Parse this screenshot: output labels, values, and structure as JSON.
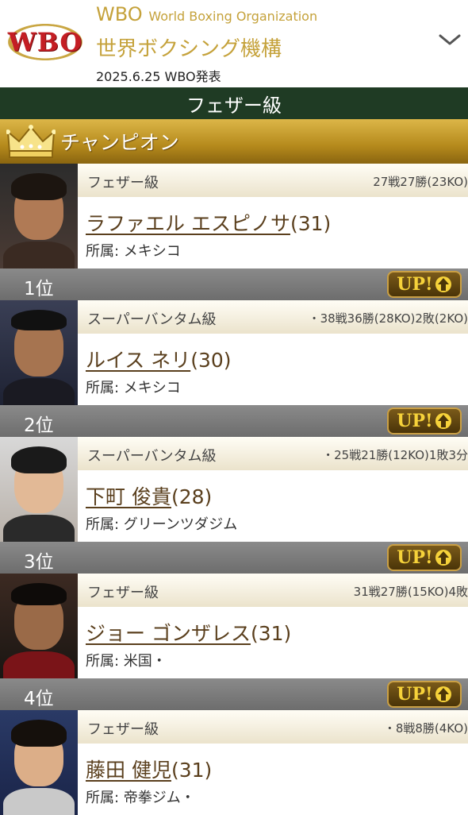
{
  "header": {
    "logo_text": "WBO",
    "org_abbr": "WBO",
    "org_full_en": "World Boxing Organization",
    "org_jp": "世界ボクシング機構",
    "announce": "2025.6.25 WBO発表"
  },
  "weight_class": "フェザー級",
  "champion_label": "チャンピオン",
  "champion": {
    "weight": "フェザー級",
    "record": "27戦27勝(23KO)",
    "name": "ラファエル エスピノサ",
    "age": "(31)",
    "affiliation": "所属: メキシコ"
  },
  "rankings": [
    {
      "rank": "1位",
      "badge": "UP!",
      "weight": "スーパーバンタム級",
      "record": "・38戦36勝(28KO)2敗(2KO)",
      "name": "ルイス ネリ",
      "age": "(30)",
      "affiliation": "所属: メキシコ"
    },
    {
      "rank": "2位",
      "badge": "UP!",
      "weight": "スーパーバンタム級",
      "record": "・25戦21勝(12KO)1敗3分",
      "name": "下町 俊貴",
      "age": "(28)",
      "affiliation": "所属: グリーンツダジム"
    },
    {
      "rank": "3位",
      "badge": "UP!",
      "weight": "フェザー級",
      "record": "31戦27勝(15KO)4敗",
      "name": "ジョー ゴンザレス",
      "age": "(31)",
      "affiliation": "所属: 米国・"
    },
    {
      "rank": "4位",
      "badge": "UP!",
      "weight": "フェザー級",
      "record": "・8戦8勝(4KO)",
      "name": "藤田 健児",
      "age": "(31)",
      "affiliation": "所属: 帝拳ジム・"
    }
  ],
  "colors": {
    "gold": "#c5a23b",
    "class_bar": "#1f3b24",
    "rank_bar": "#777777",
    "badge_text": "#f6d23a"
  }
}
